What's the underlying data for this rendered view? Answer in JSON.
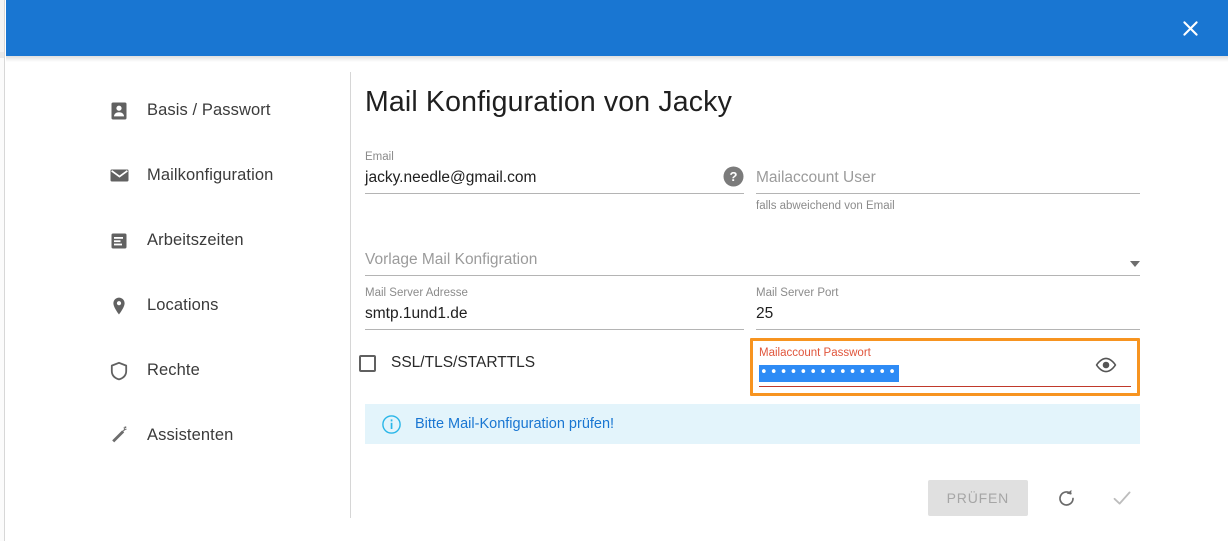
{
  "titlebar": {
    "close_label": "×",
    "color": "#1976d2"
  },
  "sidebar": {
    "items": [
      {
        "label": "Basis / Passwort",
        "icon": "person-badge-icon"
      },
      {
        "label": "Mailkonfiguration",
        "icon": "envelope-icon"
      },
      {
        "label": "Arbeitszeiten",
        "icon": "timesheet-icon"
      },
      {
        "label": "Locations",
        "icon": "map-pin-icon"
      },
      {
        "label": "Rechte",
        "icon": "shield-icon"
      },
      {
        "label": "Assistenten",
        "icon": "magic-wand-icon"
      }
    ]
  },
  "main": {
    "title": "Mail Konfiguration von Jacky",
    "fields": {
      "email": {
        "label": "Email",
        "value": "jacky.needle@gmail.com",
        "help_icon": "help-circle-icon"
      },
      "mailaccount_user": {
        "placeholder": "Mailaccount User",
        "value": "",
        "hint": "falls abweichend von Email"
      },
      "vorlage": {
        "placeholder": "Vorlage Mail Konfigration",
        "value": "",
        "caret_icon": "chevron-down-icon"
      },
      "mail_server_adresse": {
        "label": "Mail Server Adresse",
        "value": "smtp.1und1.de"
      },
      "mail_server_port": {
        "label": "Mail Server Port",
        "value": "25"
      },
      "ssl": {
        "label": "SSL/TLS/STARTTLS",
        "checked": false
      },
      "mailaccount_passwort": {
        "label": "Mailaccount Passwort",
        "value": "••••••••••••••",
        "label_color": "#e0553c",
        "highlight_color": "#f79420",
        "underline_color": "#c0392b",
        "selection_color": "#2e8bf5",
        "reveal_icon": "eye-icon"
      }
    },
    "info_banner": {
      "icon": "info-circle-icon",
      "text": "Bitte Mail-Konfiguration prüfen!",
      "background": "#e3f4fb",
      "text_color": "#1976d2"
    },
    "footer": {
      "check_button": "PRÜFEN",
      "refresh_icon": "refresh-icon",
      "confirm_icon": "check-icon"
    }
  }
}
